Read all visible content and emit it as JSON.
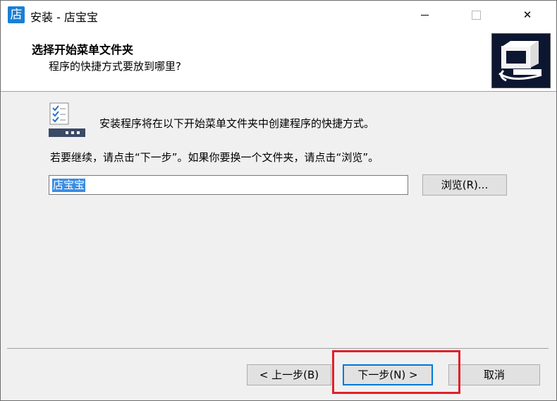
{
  "window": {
    "app_icon_char": "店",
    "title": "安装 - 店宝宝",
    "controls": [
      "minimize-icon",
      "maximize-icon",
      "close-icon"
    ],
    "close_glyph": "✕"
  },
  "header": {
    "title": "选择开始菜单文件夹",
    "subtitle": "程序的快捷方式要放到哪里?"
  },
  "body": {
    "description": "安装程序将在以下开始菜单文件夹中创建程序的快捷方式。",
    "instruction": "若要继续，请点击“下一步”。如果你要换一个文件夹，请点击“浏览”。",
    "folder_input": {
      "value": "店宝宝"
    },
    "browse_label": "浏览(R)..."
  },
  "footer": {
    "back_label": "< 上一步(B)",
    "next_label": "下一步(N) >",
    "cancel_label": "取消"
  },
  "colors": {
    "highlight": "#e0202a",
    "selection": "#3a8de4",
    "default_button_border": "#0078d7"
  }
}
